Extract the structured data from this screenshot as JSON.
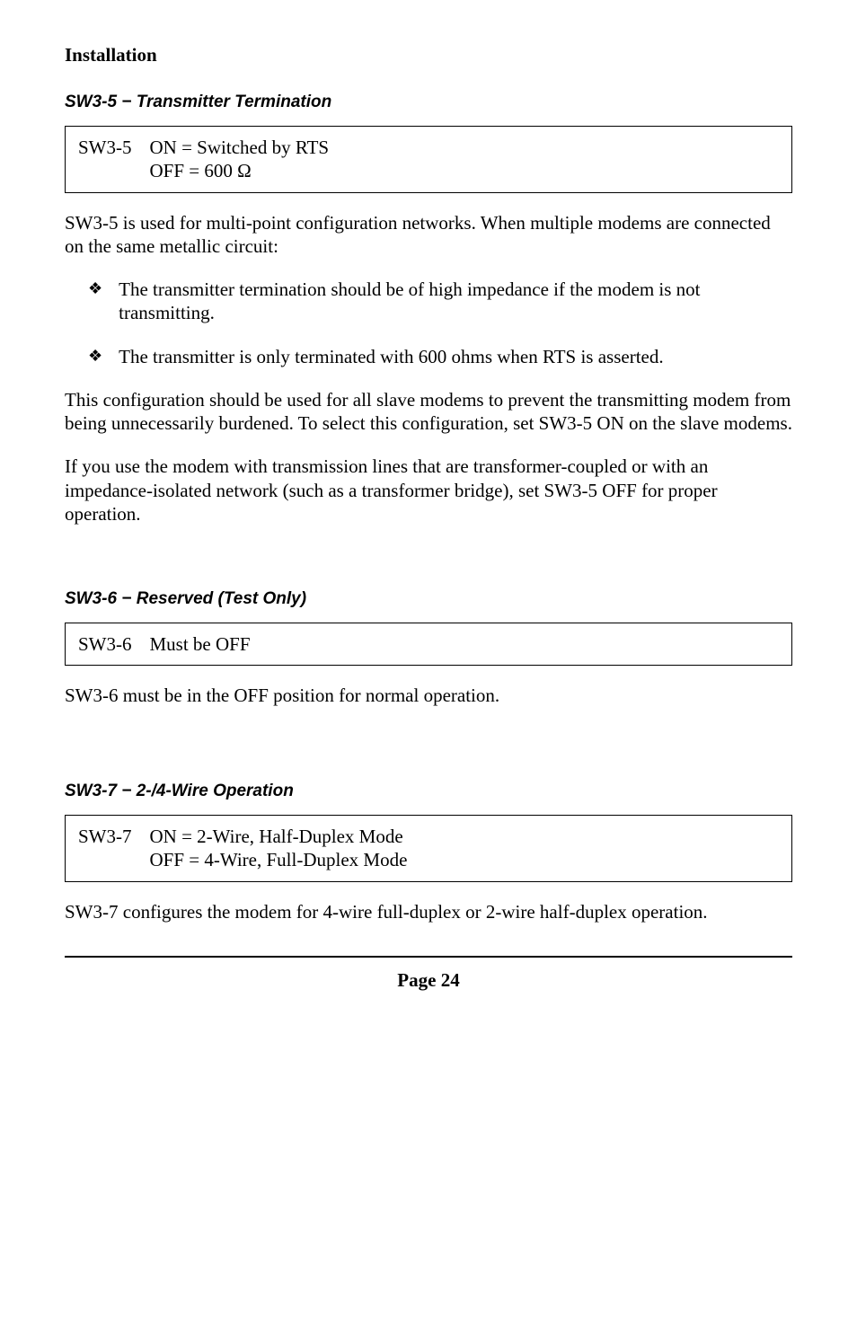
{
  "page_title": "Installation",
  "sections": {
    "sw35": {
      "label": "SW3-5 − Transmitter Termination",
      "box_key": "SW3-5",
      "box_line1": "ON = Switched by RTS",
      "box_line2": "OFF = 600 Ω",
      "para_intro": "SW3-5 is used for multi-point configuration networks. When multiple modems are connected on the same metallic circuit:",
      "bullets": [
        "The transmitter termination should be of high impedance if the modem is not transmitting.",
        "The transmitter is only terminated with 600 ohms when RTS is asserted."
      ],
      "para_after1": "This configuration should be used for all slave modems to prevent the transmitting modem from being unnecessarily burdened. To select this configuration, set SW3-5 ON on the slave modems.",
      "para_after2": "If you use the modem with transmission lines that are transformer-coupled or with an impedance-isolated network (such as a transformer bridge), set SW3-5 OFF for proper operation."
    },
    "sw36": {
      "label": "SW3-6 − Reserved (Test Only)",
      "box_key": "SW3-6",
      "box_line1": "Must be OFF",
      "para": "SW3-6 must be in the OFF position for normal operation."
    },
    "sw37": {
      "label": "SW3-7 − 2-/4-Wire Operation",
      "box_key": "SW3-7",
      "box_line1": "ON = 2-Wire, Half-Duplex Mode",
      "box_line2": "OFF = 4-Wire, Full-Duplex Mode",
      "para": "SW3-7 configures the modem for 4-wire full-duplex or 2-wire half-duplex operation."
    }
  },
  "footer": "Page 24"
}
